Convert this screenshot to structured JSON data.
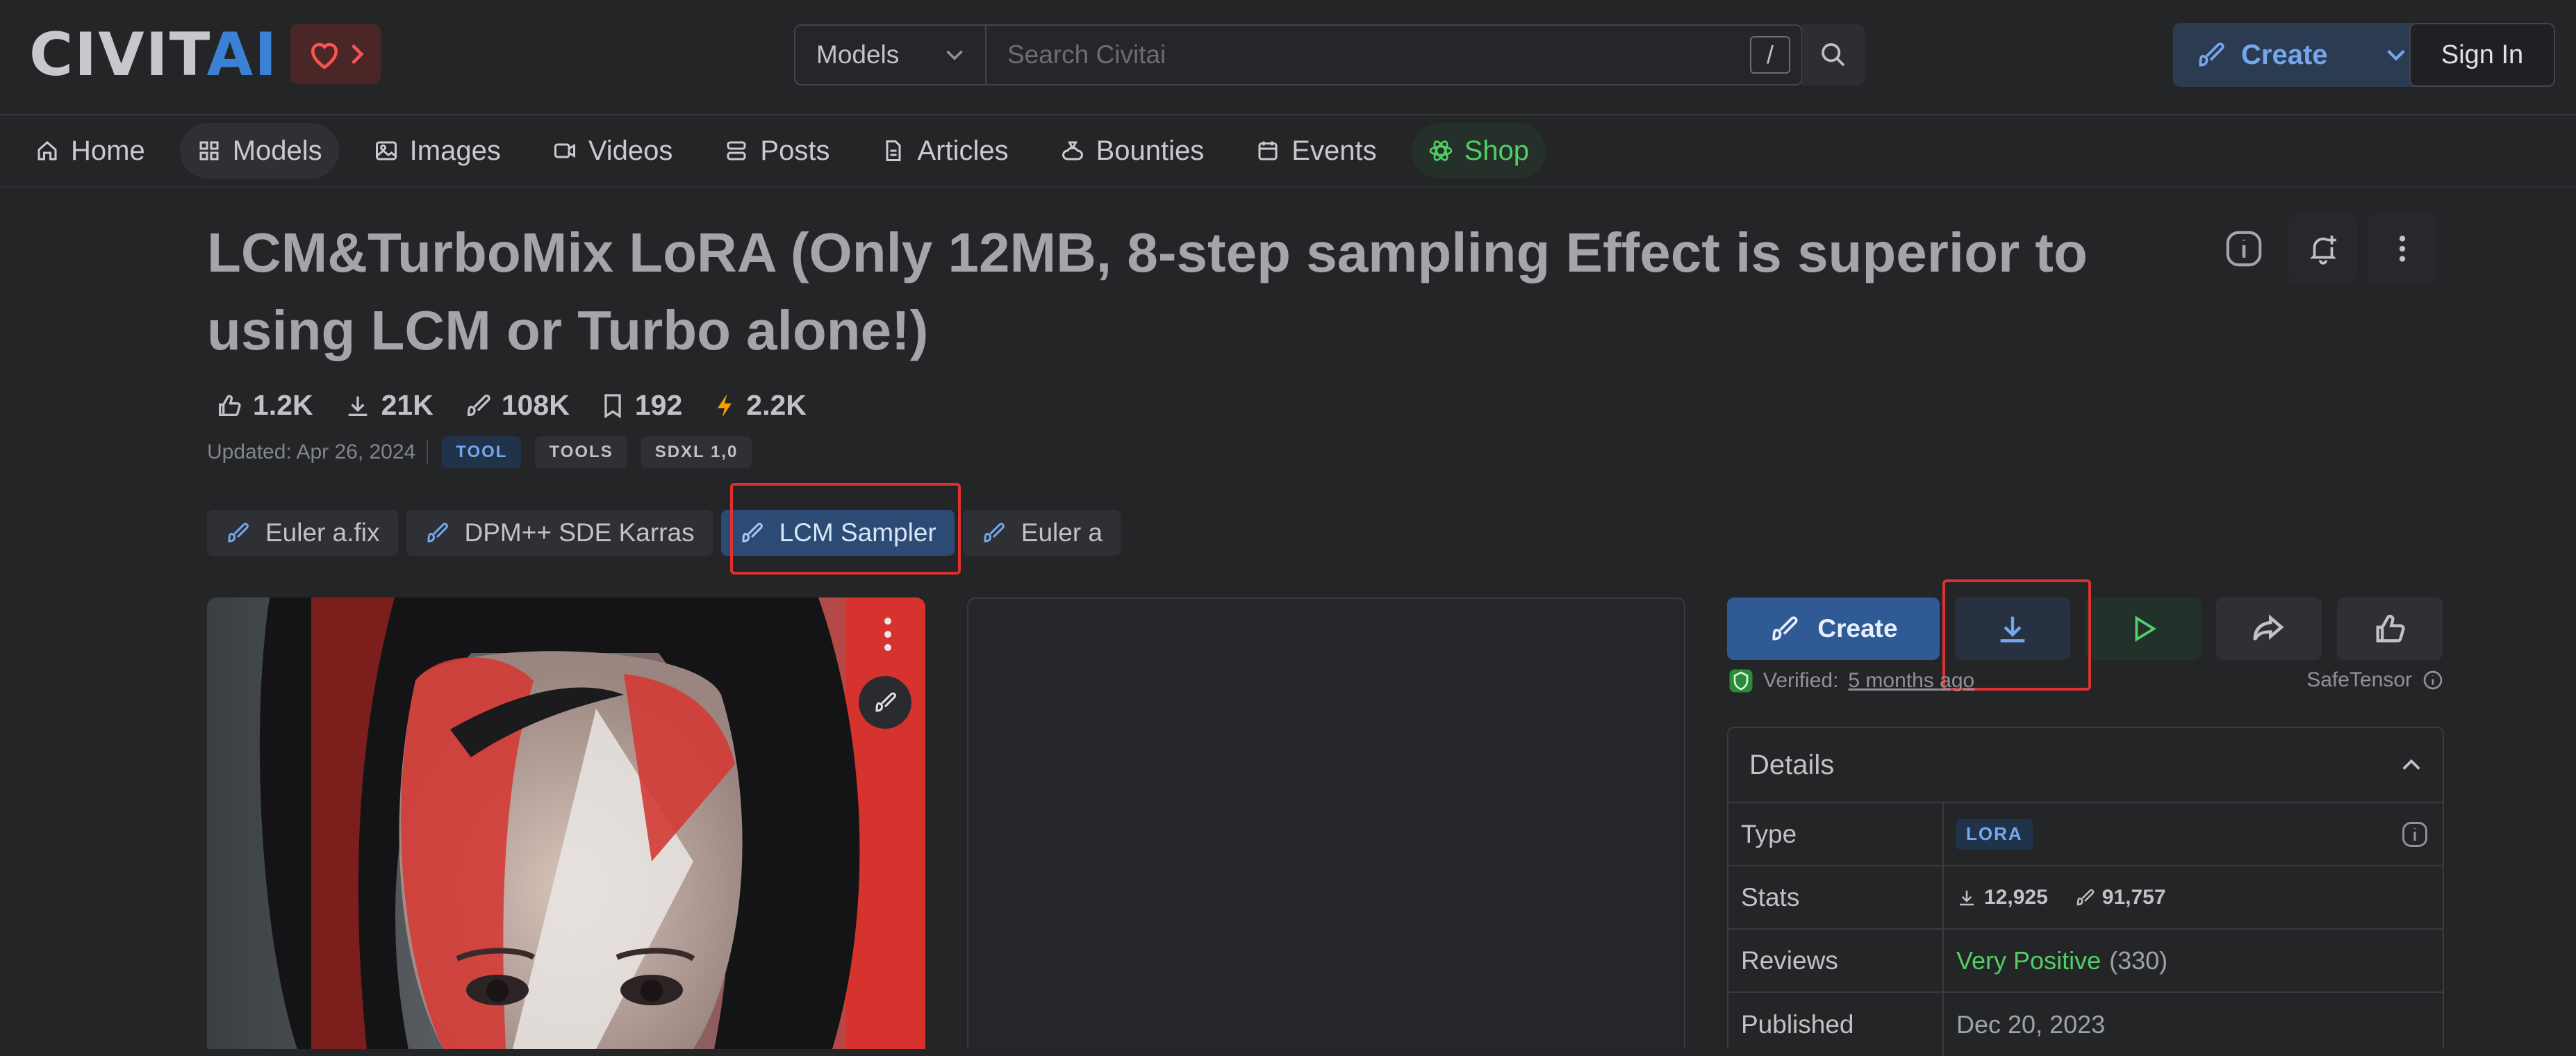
{
  "header": {
    "logo": {
      "text_main": "CIVIT",
      "text_accent": "AI"
    },
    "search": {
      "category": "Models",
      "placeholder": "Search Civitai",
      "shortcut_key": "/"
    },
    "create_label": "Create",
    "signin_label": "Sign In"
  },
  "nav": {
    "items": [
      {
        "label": "Home",
        "icon": "home-icon"
      },
      {
        "label": "Models",
        "icon": "grid-icon"
      },
      {
        "label": "Images",
        "icon": "image-icon"
      },
      {
        "label": "Videos",
        "icon": "video-icon"
      },
      {
        "label": "Posts",
        "icon": "stack-icon"
      },
      {
        "label": "Articles",
        "icon": "document-icon"
      },
      {
        "label": "Bounties",
        "icon": "moneybag-icon"
      },
      {
        "label": "Events",
        "icon": "calendar-icon"
      },
      {
        "label": "Shop",
        "icon": "atom-icon"
      }
    ]
  },
  "model": {
    "title": "LCM&TurboMix LoRA (Only 12MB, 8-step sampling Effect is superior to using LCM or Turbo alone!)",
    "stats": {
      "likes": "1.2K",
      "downloads": "21K",
      "generations": "108K",
      "collected": "192",
      "buzz": "2.2K"
    },
    "updated": "Updated: Apr 26, 2024",
    "tags": [
      "TOOL",
      "TOOLS",
      "SDXL 1,0"
    ],
    "samplers": [
      "Euler a.fix",
      "DPM++ SDE Karras",
      "LCM Sampler",
      "Euler a"
    ]
  },
  "actions": {
    "create_label": "Create",
    "verified_prefix": "Verified:",
    "verified_when": "5 months ago",
    "file_format": "SafeTensor"
  },
  "details": {
    "heading": "Details",
    "type_label": "Type",
    "type_value": "LORA",
    "stats_label": "Stats",
    "stats_downloads": "12,925",
    "stats_generations": "91,757",
    "reviews_label": "Reviews",
    "reviews_sentiment": "Very Positive",
    "reviews_count": "(330)",
    "published_label": "Published",
    "published_value": "Dec 20, 2023"
  },
  "colors": {
    "background": "#242526",
    "accent_blue": "#3b82d6",
    "selected_chip": "#2b4a74",
    "positive_green": "#51cf66",
    "highlight_red": "#e03131"
  }
}
